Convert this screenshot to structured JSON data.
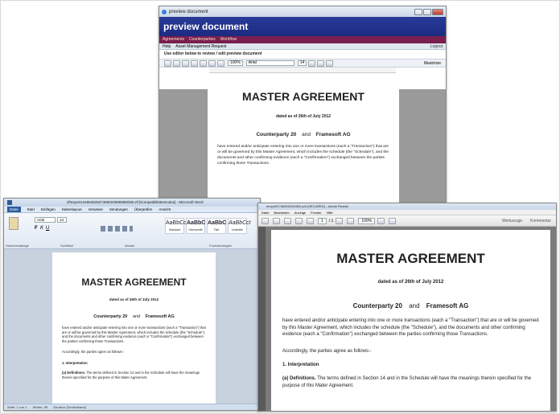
{
  "colors": {
    "banner_blue": "#1c2a80",
    "nav_maroon": "#7a1e4f",
    "word_ribbon": "#dfe8f3",
    "reader_gray": "#7b7b7b"
  },
  "web_window": {
    "title": "preview document",
    "banner": "preview document",
    "nav": [
      "Agreements",
      "Counterparties",
      "Workflow"
    ],
    "subnav": [
      "Help",
      "Asset Management Request"
    ],
    "logout": "Logout",
    "instruction": "Use editor below to review / edit preview document",
    "font_box": "Arial",
    "size_box": "14",
    "zoom_box": "100%",
    "maximize": "Maximize",
    "doc": {
      "title": "MASTER AGREEMENT",
      "dated": "dated as of 26th of July 2012",
      "cp1": "Counterparty 20",
      "and": "and",
      "cp2": "Framesoft AG",
      "para": "have entered and/or anticipate entering into one or more transactions (each a \"Transaction\") that are or will be governed by this Master Agreement, which includes the schedule (the \"Schedule\"), and the documents and other confirming evidence (each a \"Confirmation\") exchanged between the parties confirming those Transactions."
    }
  },
  "word_window": {
    "title": "dTexport13498452527469023998886/506.rtf [Kompatibilitätsmodus] - Microsoft Word",
    "tabs": [
      "Datei",
      "Start",
      "Einfügen",
      "Seitenlayout",
      "Verweise",
      "Sendungen",
      "Überprüfen",
      "Ansicht"
    ],
    "font_box": "Arial",
    "size_box": "14",
    "groups": [
      "Zwischenablage",
      "Schriftart",
      "Absatz",
      "Formatvorlagen"
    ],
    "styles": [
      {
        "sample": "AaBbCcI",
        "name": "Standard"
      },
      {
        "sample": "AaBbC",
        "name": "Überschrift"
      },
      {
        "sample": "AaBbC",
        "name": "Titel"
      },
      {
        "sample": "AaBbCcI",
        "name": "Untertitel"
      }
    ],
    "status": [
      "Seite: 1 von 1",
      "Wörter: 95",
      "Deutsch (Deutschland)"
    ],
    "doc": {
      "title": "MASTER AGREEMENT",
      "dated": "dated as of 26th of July 2012",
      "cp1": "Counterparty 20",
      "and": "and",
      "cp2": "Framesoft AG",
      "para": "have entered and/or anticipate entering into one or more transactions (each a \"Transaction\") that are or will be governed by this Master Agreement, which includes the schedule (the \"Schedule\"), and the documents and other confirming evidence (each a \"Confirmation\") exchanged between the parties confirming those Transactions.",
      "accord": "Accordingly, the parties agree as follows:-",
      "section": "1. Interpretation",
      "def_label": "(a) Definitions.",
      "def_text": "The terms defined in Section 14 and in the Schedule will have the meanings therein specified for the purpose of this Mater Agreement."
    }
  },
  "reader_window": {
    "title": "hexp4/07/4634620408/2.pdf (SECURED) - Adobe Reader",
    "menu": [
      "Datei",
      "Bearbeiten",
      "Anzeige",
      "Fenster",
      "Hilfe"
    ],
    "page_current": "1",
    "page_total": "/ 1",
    "zoom": "100%",
    "right_tools": [
      "Werkzeuge",
      "Kommentar"
    ],
    "doc": {
      "title": "MASTER AGREEMENT",
      "dated": "dated as of 26th of July 2012",
      "cp1": "Counterparty 20",
      "and": "and",
      "cp2": "Framesoft AG",
      "para": "have entered and/or anticipate entering into one or more transactions (each a \"Transaction\") that are or will be governed by this Master Agreement, which includes the schedule (the \"Schedule\"), and the documents and other confirming evidence (each a \"Confirmation\") exchanged between the parties confirming those Transactions.",
      "accord": "Accordingly, the parties agree as follows:-",
      "section": "1. Interpretation",
      "def_label": "(a) Definitions.",
      "def_text": "The terms defined in Section 14 and in the Schedule will have the meanings therein specified for the purpose of this Mater Agreement."
    }
  }
}
